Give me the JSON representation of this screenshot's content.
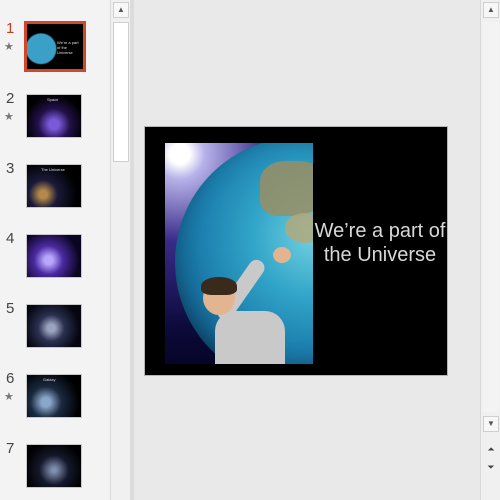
{
  "slides": [
    {
      "number": "1",
      "starred": true,
      "active": true,
      "thumb_title": "We're a part of the Universe"
    },
    {
      "number": "2",
      "starred": true,
      "active": false,
      "thumb_title": "Space"
    },
    {
      "number": "3",
      "starred": false,
      "active": false,
      "thumb_title": "The Universe"
    },
    {
      "number": "4",
      "starred": false,
      "active": false,
      "thumb_title": ""
    },
    {
      "number": "5",
      "starred": false,
      "active": false,
      "thumb_title": ""
    },
    {
      "number": "6",
      "starred": true,
      "active": false,
      "thumb_title": "Galaxy"
    },
    {
      "number": "7",
      "starred": false,
      "active": false,
      "thumb_title": ""
    }
  ],
  "main_slide": {
    "title_line1": "We’re a part of",
    "title_line2": "the Universe"
  },
  "icons": {
    "star": "★",
    "scroll_up": "▲",
    "scroll_down": "▼",
    "prev_slide": "⏶",
    "next_slide": "⏷"
  },
  "colors": {
    "active_number": "#c43e1c",
    "selection_border": "#d24726"
  }
}
